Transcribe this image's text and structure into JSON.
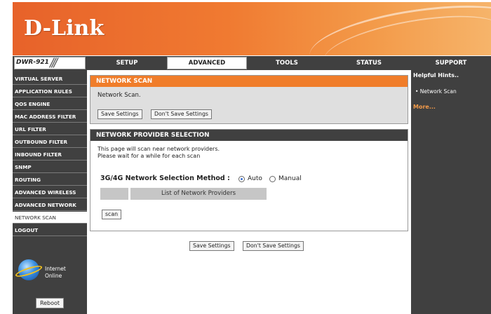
{
  "header": {
    "logo": "D-Link"
  },
  "nav": {
    "model": "DWR-921",
    "slashes": "///",
    "tabs": [
      {
        "label": "SETUP"
      },
      {
        "label": "ADVANCED"
      },
      {
        "label": "TOOLS"
      },
      {
        "label": "STATUS"
      },
      {
        "label": "SUPPORT"
      }
    ]
  },
  "sidebar": {
    "items": [
      {
        "label": "VIRTUAL SERVER"
      },
      {
        "label": "APPLICATION RULES"
      },
      {
        "label": "QOS ENGINE"
      },
      {
        "label": "MAC ADDRESS FILTER"
      },
      {
        "label": "URL FILTER"
      },
      {
        "label": "OUTBOUND FILTER"
      },
      {
        "label": "INBOUND FILTER"
      },
      {
        "label": "SNMP"
      },
      {
        "label": "ROUTING"
      },
      {
        "label": "ADVANCED WIRELESS"
      },
      {
        "label": "ADVANCED NETWORK"
      },
      {
        "label": "NETWORK SCAN"
      },
      {
        "label": "LOGOUT"
      }
    ],
    "status_line1": "Internet",
    "status_line2": "Online",
    "reboot_label": "Reboot"
  },
  "network_scan": {
    "title": "NETWORK SCAN",
    "description": "Network Scan.",
    "save_label": "Save Settings",
    "dont_save_label": "Don't Save Settings"
  },
  "provider_selection": {
    "title": "NETWORK PROVIDER SELECTION",
    "intro_line1": "This page will scan near network providers.",
    "intro_line2": "Please wait for a while for each scan",
    "method_label": "3G/4G Network Selection Method :",
    "option_auto": "Auto",
    "option_manual": "Manual",
    "selected_method": "Auto",
    "list_header": "List of Network Providers",
    "scan_label": "scan"
  },
  "bottom_buttons": {
    "save_label": "Save Settings",
    "dont_save_label": "Don't Save Settings"
  },
  "helper": {
    "title": "Helpful Hints..",
    "item": "• Network Scan",
    "more": "More..."
  },
  "colors": {
    "accent_orange": "#f07d2a",
    "dark_panel": "#404040",
    "more_link": "#f39a49"
  }
}
